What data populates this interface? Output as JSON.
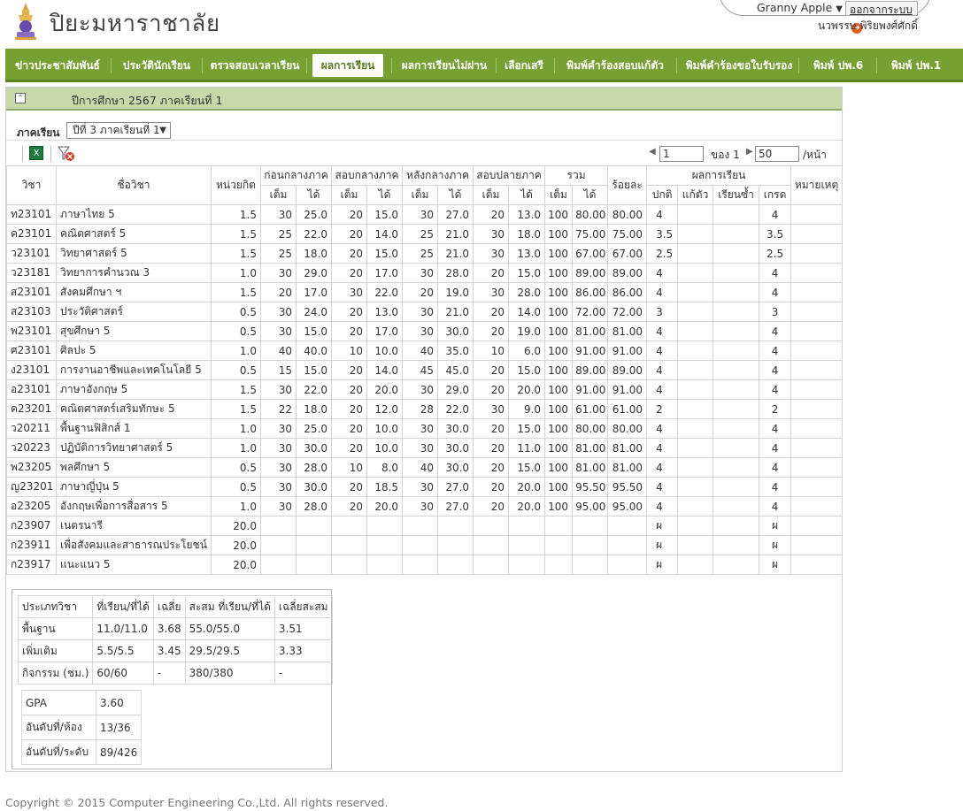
{
  "header": {
    "site_title": "ปิยะมหาราชาลัย",
    "user_select": "Granny Apple",
    "logout_label": "ออกจากระบบ",
    "user_name": "นวพรรษ  พิริยพงศ์ศักดิ์"
  },
  "nav": [
    {
      "label": "ข่าวประชาสัมพันธ์"
    },
    {
      "label": "ประวัตินักเรียน"
    },
    {
      "label": "ตรวจสอบเวลาเรียน"
    },
    {
      "label": "ผลการเรียน"
    },
    {
      "label": "ผลการเรียนไม่ผ่าน"
    },
    {
      "label": "เลือกเสรี"
    },
    {
      "label": "พิมพ์คำร้องสอบแก้ตัว"
    },
    {
      "label": "พิมพ์คำร้องขอใบรับรอง"
    },
    {
      "label": "พิมพ์ ปพ.6"
    },
    {
      "label": "พิมพ์ ปพ.1"
    }
  ],
  "panel": {
    "title": "ปีการศึกษา  2567  ภาคเรียนที่  1",
    "term_label": "ภาคเรียน",
    "term_value": "ปีที่  3  ภาคเรียนที่  1"
  },
  "pager": {
    "page": "1",
    "of_label": "ของ  1",
    "size": "50",
    "per_page": "/หน้า"
  },
  "table": {
    "headers": {
      "code": "วิชา",
      "name": "ชื่อวิชา",
      "credit": "หน่วยกิต",
      "g1": "ก่อนกลางภาค",
      "g2": "สอบกลางภาค",
      "g3": "หลังกลางภาค",
      "g4": "สอบปลายภาค",
      "g5": "รวม",
      "full": "เต็ม",
      "got": "ได้",
      "percent": "ร้อยละ",
      "result": "ผลการเรียน",
      "normal": "ปกติ",
      "fix": "แก้ตัว",
      "repeat": "เรียนซ้ำ",
      "grade": "เกรด",
      "note": "หมายเหตุ"
    },
    "rows": [
      [
        "ท23101",
        "ภาษาไทย  5",
        "1.5",
        "30",
        "25.0",
        "20",
        "15.0",
        "30",
        "27.0",
        "20",
        "13.0",
        "100",
        "80.00",
        "80.00",
        "4",
        "",
        "",
        "4",
        ""
      ],
      [
        "ค23101",
        "คณิตศาสตร์  5",
        "1.5",
        "25",
        "22.0",
        "20",
        "14.0",
        "25",
        "21.0",
        "30",
        "18.0",
        "100",
        "75.00",
        "75.00",
        "3.5",
        "",
        "",
        "3.5",
        ""
      ],
      [
        "ว23101",
        "วิทยาศาสตร์  5",
        "1.5",
        "25",
        "18.0",
        "20",
        "15.0",
        "25",
        "21.0",
        "30",
        "13.0",
        "100",
        "67.00",
        "67.00",
        "2.5",
        "",
        "",
        "2.5",
        ""
      ],
      [
        "ว23181",
        "วิทยาการคำนวณ  3",
        "1.0",
        "30",
        "29.0",
        "20",
        "17.0",
        "30",
        "28.0",
        "20",
        "15.0",
        "100",
        "89.00",
        "89.00",
        "4",
        "",
        "",
        "4",
        ""
      ],
      [
        "ส23101",
        "สังคมศึกษา  ฯ",
        "1.5",
        "20",
        "17.0",
        "30",
        "22.0",
        "20",
        "19.0",
        "30",
        "28.0",
        "100",
        "86.00",
        "86.00",
        "4",
        "",
        "",
        "4",
        ""
      ],
      [
        "ส23103",
        "ประวัติศาสตร์",
        "0.5",
        "30",
        "24.0",
        "20",
        "13.0",
        "30",
        "21.0",
        "20",
        "14.0",
        "100",
        "72.00",
        "72.00",
        "3",
        "",
        "",
        "3",
        ""
      ],
      [
        "พ23101",
        "สุขศึกษา  5",
        "0.5",
        "30",
        "15.0",
        "20",
        "17.0",
        "30",
        "30.0",
        "20",
        "19.0",
        "100",
        "81.00",
        "81.00",
        "4",
        "",
        "",
        "4",
        ""
      ],
      [
        "ศ23101",
        "ศิลปะ  5",
        "1.0",
        "40",
        "40.0",
        "10",
        "10.0",
        "40",
        "35.0",
        "10",
        "6.0",
        "100",
        "91.00",
        "91.00",
        "4",
        "",
        "",
        "4",
        ""
      ],
      [
        "ง23101",
        "การงานอาชีพและเทคโนโลยี  5",
        "0.5",
        "15",
        "15.0",
        "20",
        "14.0",
        "45",
        "45.0",
        "20",
        "15.0",
        "100",
        "89.00",
        "89.00",
        "4",
        "",
        "",
        "4",
        ""
      ],
      [
        "อ23101",
        "ภาษาอังกฤษ  5",
        "1.5",
        "30",
        "22.0",
        "20",
        "20.0",
        "30",
        "29.0",
        "20",
        "20.0",
        "100",
        "91.00",
        "91.00",
        "4",
        "",
        "",
        "4",
        ""
      ],
      [
        "ค23201",
        "คณิตศาสตร์เสริมทักษะ  5",
        "1.5",
        "22",
        "18.0",
        "20",
        "12.0",
        "28",
        "22.0",
        "30",
        "9.0",
        "100",
        "61.00",
        "61.00",
        "2",
        "",
        "",
        "2",
        ""
      ],
      [
        "ว20211",
        "พื้นฐานฟิสิกส์  1",
        "1.0",
        "30",
        "25.0",
        "20",
        "10.0",
        "30",
        "30.0",
        "20",
        "15.0",
        "100",
        "80.00",
        "80.00",
        "4",
        "",
        "",
        "4",
        ""
      ],
      [
        "ว20223",
        "ปฏิบัติการวิทยาศาสตร์  5",
        "1.0",
        "30",
        "30.0",
        "20",
        "10.0",
        "30",
        "30.0",
        "20",
        "11.0",
        "100",
        "81.00",
        "81.00",
        "4",
        "",
        "",
        "4",
        ""
      ],
      [
        "พ23205",
        "พลศึกษา  5",
        "0.5",
        "30",
        "28.0",
        "10",
        "8.0",
        "40",
        "30.0",
        "20",
        "15.0",
        "100",
        "81.00",
        "81.00",
        "4",
        "",
        "",
        "4",
        ""
      ],
      [
        "ญ23201",
        "ภาษาญี่ปุ่น  5",
        "0.5",
        "30",
        "30.0",
        "20",
        "18.5",
        "30",
        "27.0",
        "20",
        "20.0",
        "100",
        "95.50",
        "95.50",
        "4",
        "",
        "",
        "4",
        ""
      ],
      [
        "อ23205",
        "อังกฤษเพื่อการสื่อสาร  5",
        "1.0",
        "30",
        "28.0",
        "20",
        "20.0",
        "30",
        "27.0",
        "20",
        "20.0",
        "100",
        "95.00",
        "95.00",
        "4",
        "",
        "",
        "4",
        ""
      ],
      [
        "ก23907",
        "เนตรนารี",
        "20.0",
        "",
        "",
        "",
        "",
        "",
        "",
        "",
        "",
        "",
        "",
        "",
        "ผ",
        "",
        "",
        "ผ",
        ""
      ],
      [
        "ก23911",
        "เพื่อสังคมและสาธารณประโยชน์  5",
        "20.0",
        "",
        "",
        "",
        "",
        "",
        "",
        "",
        "",
        "",
        "",
        "",
        "ผ",
        "",
        "",
        "ผ",
        ""
      ],
      [
        "ก23917",
        "แนะแนว  5",
        "20.0",
        "",
        "",
        "",
        "",
        "",
        "",
        "",
        "",
        "",
        "",
        "",
        "ผ",
        "",
        "",
        "ผ",
        ""
      ]
    ]
  },
  "summary": {
    "headers": [
      "ประเภทวิชา",
      "ที่เรียน/ที่ได้",
      "เฉลี่ย",
      "สะสม  ที่เรียน/ที่ได้",
      "เฉลี่ยสะสม"
    ],
    "rows": [
      [
        "พื้นฐาน",
        "11.0/11.0",
        "3.68",
        "55.0/55.0",
        "3.51"
      ],
      [
        "เพิ่มเติม",
        "5.5/5.5",
        "3.45",
        "29.5/29.5",
        "3.33"
      ],
      [
        "กิจกรรม  (ชม.)",
        "60/60",
        "-",
        "380/380",
        "-"
      ]
    ],
    "gpa": [
      [
        "GPA",
        "3.60"
      ],
      [
        "อันดับที่/ห้อง",
        "13/36"
      ],
      [
        "อันดับที่/ระดับ",
        "89/426"
      ]
    ]
  },
  "footer": "Copyright © 2015 Computer Engineering Co.,Ltd. All rights reserved.",
  "colors": {
    "nav": "#76a132",
    "panel_head": "#c9d8a9"
  },
  "icons": [
    "logo-emblem",
    "chevron-down-icon",
    "logout-arrow-icon",
    "collapse-icon",
    "excel-icon",
    "filter-clear-icon",
    "prev-arrow-icon",
    "next-arrow-icon"
  ]
}
